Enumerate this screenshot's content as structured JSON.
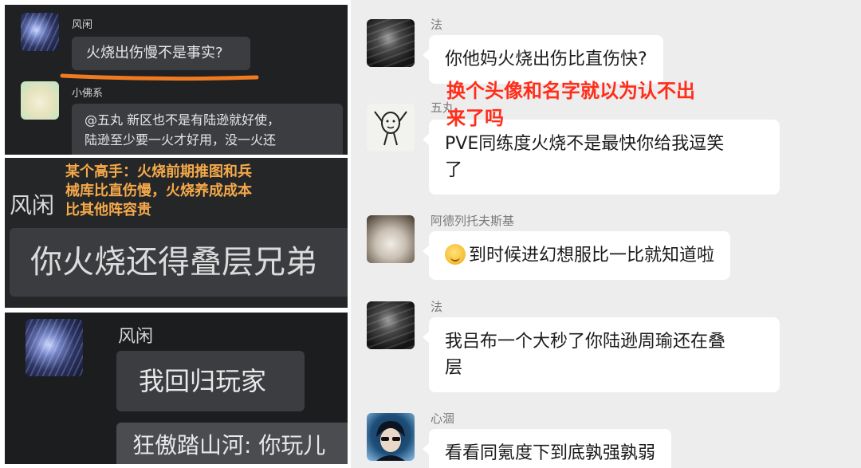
{
  "left": {
    "panel1": {
      "msg1": {
        "name": "风闲",
        "text": "火烧出伤慢不是事实?"
      },
      "msg2": {
        "name": "小佛系",
        "text_lines": [
          "@五丸  新区也不是有陆逊就好使，",
          "陆逊至少要一火才好用，没一火还"
        ]
      }
    },
    "panel2": {
      "caption_lines": [
        "某个高手：火烧前期推图和兵",
        "械库比直伤慢，火烧养成成本",
        "比其他阵容贵"
      ],
      "name": "风闲",
      "text": "你火烧还得叠层兄弟"
    },
    "panel3": {
      "name": "风闲",
      "text": "我回归玩家",
      "partial_text": "狂傲踏山河:  你玩儿"
    },
    "colors": {
      "highlight_underline": "#f07a22",
      "caption": "#f5a94a"
    }
  },
  "right": {
    "messages": [
      {
        "name": "法",
        "avatar_icon": "dark-anime-avatar-icon",
        "text": "你他妈火烧出伤比直伤快?"
      },
      {
        "name": "五丸",
        "avatar_icon": "doodle-character-avatar-icon",
        "text_lines": [
          "PVE同练度火烧不是最快你给我逗笑",
          "了"
        ]
      },
      {
        "name": "阿德列托夫斯基",
        "avatar_icon": "husky-dog-avatar-icon",
        "emoji": "thinking-face-emoji",
        "text": "到时候进幻想服比一比就知道啦"
      },
      {
        "name": "法",
        "avatar_icon": "dark-anime-avatar-icon",
        "text_lines": [
          "我吕布一个大秒了你陆逊周瑜还在叠",
          "层"
        ]
      },
      {
        "name": "心涸",
        "avatar_icon": "sunglasses-boy-avatar-icon",
        "text": "看看同氪度下到底孰强孰弱"
      }
    ],
    "overlay_lines": [
      "换个头像和名字就以为认不出",
      "来了吗"
    ],
    "colors": {
      "overlay": "#ff2d1a",
      "background": "#ededed",
      "bubble": "#ffffff"
    }
  }
}
